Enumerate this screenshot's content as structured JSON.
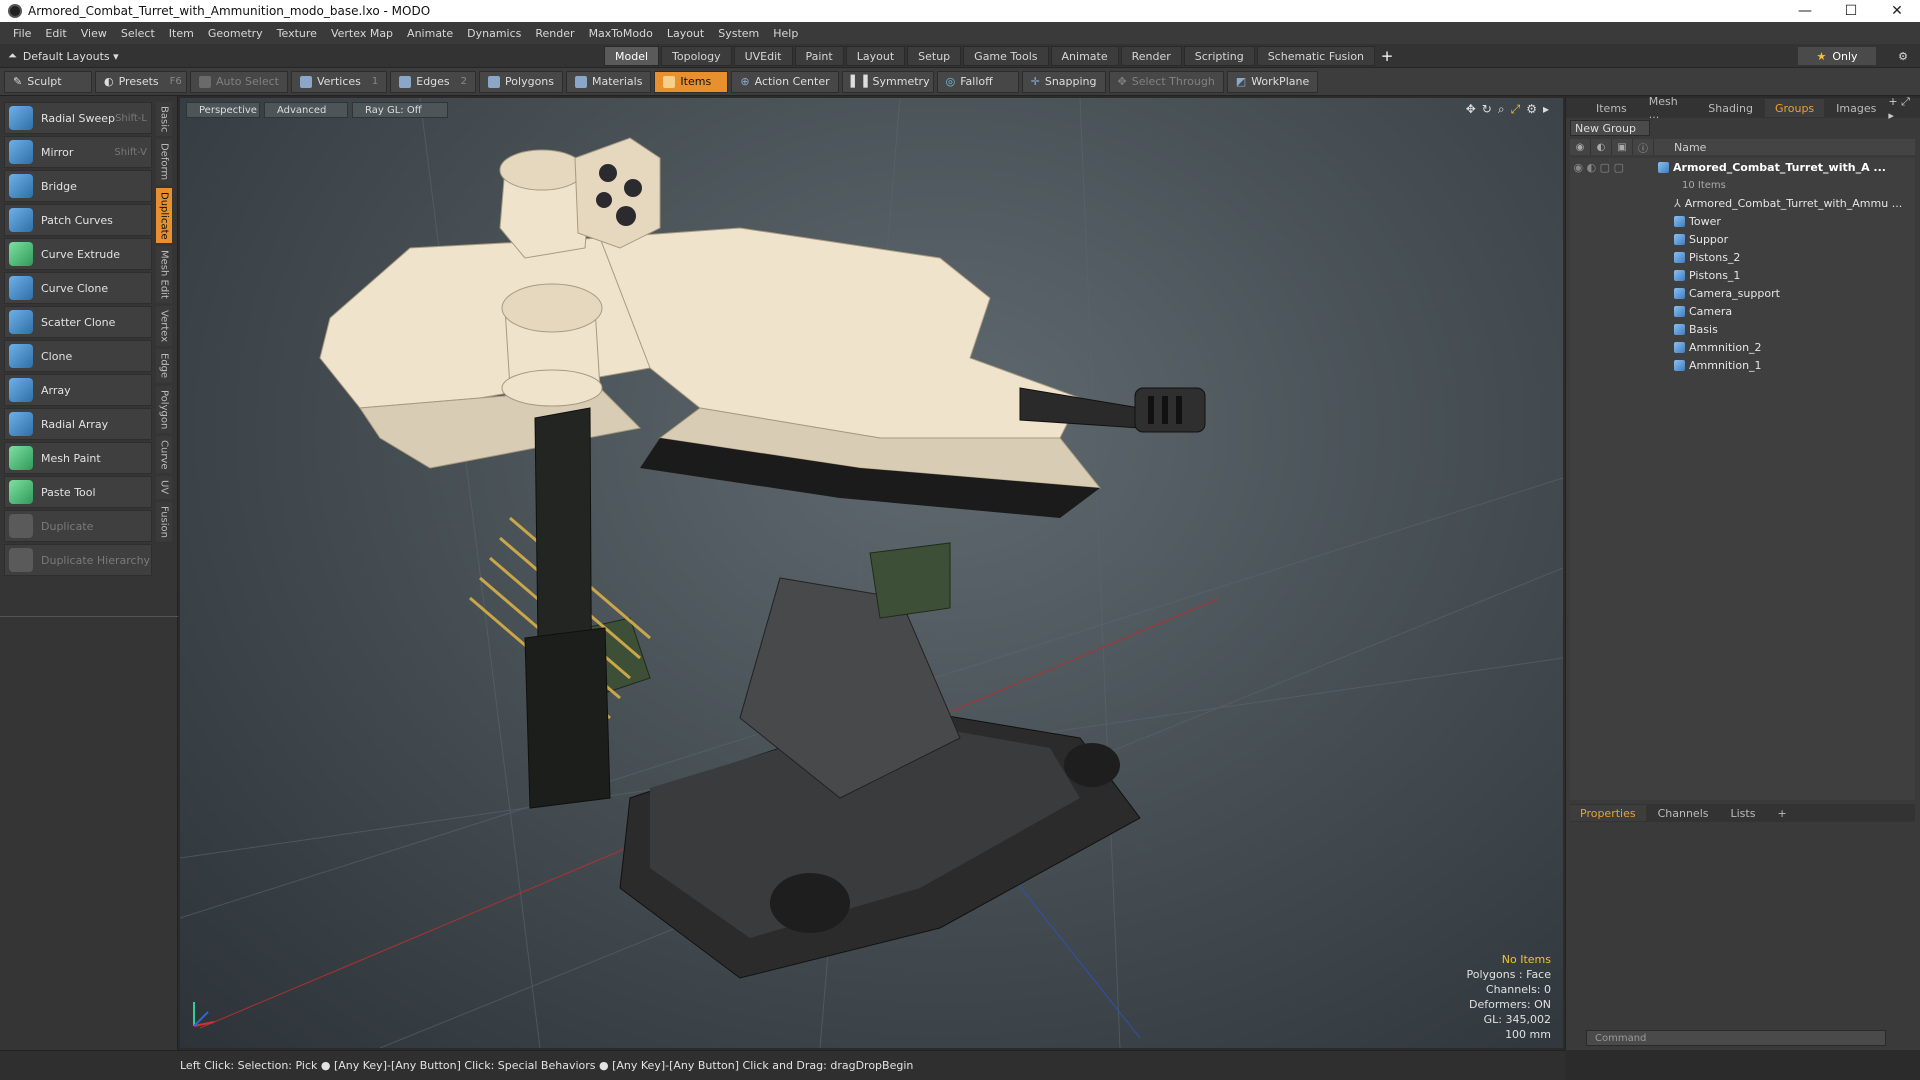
{
  "window": {
    "title": "Armored_Combat_Turret_with_Ammunition_modo_base.lxo - MODO",
    "minimize": "—",
    "maximize": "☐",
    "close": "✕"
  },
  "menu": [
    "File",
    "Edit",
    "View",
    "Select",
    "Item",
    "Geometry",
    "Texture",
    "Vertex Map",
    "Animate",
    "Dynamics",
    "Render",
    "MaxToModo",
    "Layout",
    "System",
    "Help"
  ],
  "layoutbar": {
    "layouts_label": "Default Layouts ▾",
    "tabs": [
      "Model",
      "Topology",
      "UVEdit",
      "Paint",
      "Layout",
      "Setup",
      "Game Tools",
      "Animate",
      "Render",
      "Scripting",
      "Schematic Fusion"
    ],
    "active_tab": "Model",
    "only_label": "Only",
    "plus": "+"
  },
  "toolbar": {
    "sculpt": "Sculpt",
    "presets": "Presets",
    "presets_key": "F6",
    "auto_select": "Auto Select",
    "vertices": "Vertices",
    "vertices_count": "1",
    "edges": "Edges",
    "edges_count": "2",
    "polygons": "Polygons",
    "materials": "Materials",
    "items": "Items",
    "action_center": "Action Center",
    "symmetry": "Symmetry",
    "falloff": "Falloff",
    "snapping": "Snapping",
    "select_through": "Select Through",
    "workplane": "WorkPlane"
  },
  "tools": [
    {
      "label": "Radial Sweep",
      "key": "Shift-L"
    },
    {
      "label": "Mirror",
      "key": "Shift-V"
    },
    {
      "label": "Bridge",
      "key": ""
    },
    {
      "label": "Patch Curves",
      "key": ""
    },
    {
      "label": "Curve Extrude",
      "key": ""
    },
    {
      "label": "Curve Clone",
      "key": ""
    },
    {
      "label": "Scatter Clone",
      "key": ""
    },
    {
      "label": "Clone",
      "key": ""
    },
    {
      "label": "Array",
      "key": ""
    },
    {
      "label": "Radial Array",
      "key": ""
    },
    {
      "label": "Mesh Paint",
      "key": ""
    },
    {
      "label": "Paste Tool",
      "key": ""
    },
    {
      "label": "Duplicate",
      "key": ""
    },
    {
      "label": "Duplicate Hierarchy",
      "key": ""
    }
  ],
  "vtabs": [
    "Basic",
    "Deform",
    "Duplicate",
    "Mesh Edit",
    "Vertex",
    "Edge",
    "Polygon",
    "Curve",
    "UV",
    "Fusion"
  ],
  "viewport": {
    "view": "Perspective",
    "mode": "Advanced",
    "raygl": "Ray GL: Off",
    "info": {
      "no_items": "No Items",
      "polygons": "Polygons : Face",
      "channels": "Channels: 0",
      "deformers": "Deformers: ON",
      "gl": "GL: 345,002",
      "scale": "100 mm"
    }
  },
  "rightpanel": {
    "tabs": [
      "Items",
      "Mesh ...",
      "Shading",
      "Groups",
      "Images"
    ],
    "active_tab": "Groups",
    "new_group": "New Group",
    "name_col": "Name",
    "root": "Armored_Combat_Turret_with_A ...",
    "root_sub": "10 Items",
    "items": [
      "Armored_Combat_Turret_with_Ammu ...",
      "Tower",
      "Suppor",
      "Pistons_2",
      "Pistons_1",
      "Camera_support",
      "Camera",
      "Basis",
      "Ammnition_2",
      "Ammnition_1"
    ],
    "bottom_tabs": [
      "Properties",
      "Channels",
      "Lists"
    ],
    "command_placeholder": "Command"
  },
  "status": {
    "text": "Left Click: Selection: Pick ● [Any Key]-[Any Button] Click: Special Behaviors ● [Any Key]-[Any Button] Click and Drag: dragDropBegin"
  },
  "colors": {
    "accent": "#e8902e",
    "warn": "#f2c230",
    "body": "#efe3cc",
    "metal": "#2b2b2b"
  }
}
